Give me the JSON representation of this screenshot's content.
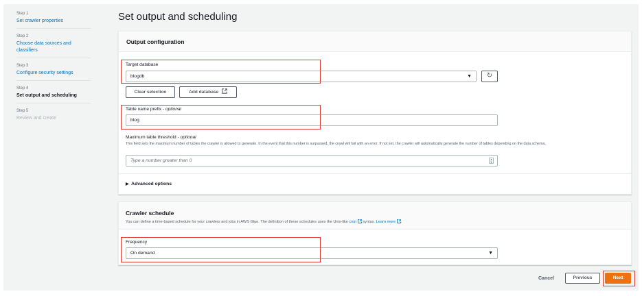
{
  "sidebar": {
    "steps": [
      {
        "num": "Step 1",
        "label": "Set crawler properties"
      },
      {
        "num": "Step 2",
        "label": "Choose data sources and classifiers"
      },
      {
        "num": "Step 3",
        "label": "Configure security settings"
      },
      {
        "num": "Step 4",
        "label": "Set output and scheduling"
      },
      {
        "num": "Step 5",
        "label": "Review and create"
      }
    ]
  },
  "page": {
    "title": "Set output and scheduling"
  },
  "output": {
    "header": "Output configuration",
    "target_db_label": "Target database",
    "target_db_value": "blogdb",
    "clear_label": "Clear selection",
    "add_db_label": "Add database",
    "prefix_label": "Table name prefix - ",
    "prefix_optional": "optional",
    "prefix_value": "blog",
    "threshold_label": "Maximum table threshold - ",
    "threshold_optional": "optional",
    "threshold_desc": "This field sets the maximum number of tables the crawler is allowed to generate. In the event that this number is surpassed, the crawl will fail with an error. If not set, the crawler will automatically generate the number of tables depending on the data schema.",
    "threshold_placeholder": "Type a number greater than 0",
    "advanced_label": "Advanced options"
  },
  "schedule": {
    "header": "Crawler schedule",
    "desc_before": "You can define a time-based schedule for your crawlers and jobs in AWS Glue. The definition of these schedules uses the Unix-like",
    "cron_link": "cron",
    "desc_after": "syntax.",
    "learn_more": "Learn more",
    "frequency_label": "Frequency",
    "frequency_value": "On demand"
  },
  "footer": {
    "cancel": "Cancel",
    "previous": "Previous",
    "next": "Next"
  },
  "colors": {
    "accent": "#ec7211",
    "link": "#0073bb",
    "highlight": "#e0382f"
  },
  "icons": {
    "refresh": "refresh-icon",
    "external": "external-link-icon",
    "caret": "caret-down-icon",
    "triangle": "caret-right-icon",
    "spinner": "number-spinner-icon"
  }
}
